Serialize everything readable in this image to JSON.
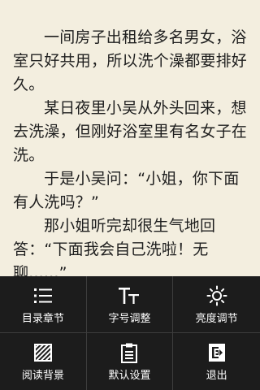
{
  "reader": {
    "paragraphs": [
      "一间房子出租给多名男女，浴室只好共用，所以洗个澡都要排好久。",
      "某日夜里小吴从外头回来，想去洗澡，但刚好浴室里有名女子在洗。",
      "于是小吴问：“小姐，你下面有人洗吗？”",
      "那小姐听完却很生气地回答：“下面我会自己洗啦！无聊......”"
    ]
  },
  "menu": {
    "items": [
      {
        "label": "目录章节",
        "icon": "list-icon"
      },
      {
        "label": "字号调整",
        "icon": "font-size-icon"
      },
      {
        "label": "亮度调节",
        "icon": "brightness-icon"
      },
      {
        "label": "阅读背景",
        "icon": "background-icon"
      },
      {
        "label": "默认设置",
        "icon": "clipboard-icon"
      },
      {
        "label": "退出",
        "icon": "exit-icon"
      }
    ]
  },
  "colors": {
    "page_background": "#f3eedf",
    "text": "#1e1e1e",
    "menu_background": "#1c1c1c",
    "menu_text": "#ffffff"
  }
}
